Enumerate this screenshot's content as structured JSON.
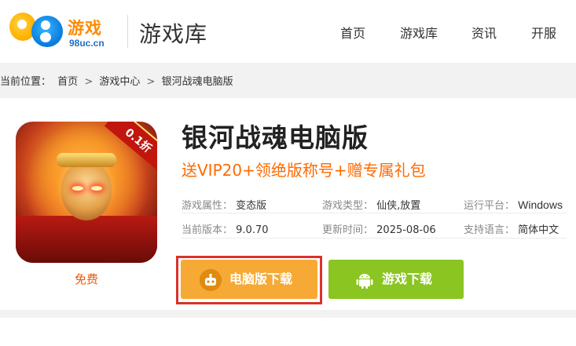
{
  "header": {
    "logo_text": "游戏",
    "logo_sub": "98uc.cn",
    "site_title": "游戏库",
    "nav": [
      "首页",
      "游戏库",
      "资讯",
      "开服"
    ]
  },
  "breadcrumb": {
    "prefix": "当前位置：",
    "items": [
      "首页",
      "游戏中心",
      "银河战魂电脑版"
    ],
    "separator": ">"
  },
  "game": {
    "title": "银河战魂电脑版",
    "promo": "送VIP20+领绝版称号+赠专属礼包",
    "badge": "0.1折",
    "price": "免费",
    "attributes": [
      {
        "key": "游戏属性：",
        "value": "变态版"
      },
      {
        "key": "游戏类型：",
        "value": "仙侠,放置"
      },
      {
        "key": "运行平台：",
        "value": "Windows"
      },
      {
        "key": "当前版本：",
        "value": "9.0.70"
      },
      {
        "key": "更新时间：",
        "value": "2025-08-06"
      },
      {
        "key": "支持语言：",
        "value": "简体中文"
      }
    ]
  },
  "buttons": {
    "pc_download": "电脑版下载",
    "game_download": "游戏下载"
  },
  "colors": {
    "accent_orange": "#f6a935",
    "accent_green": "#8ac522",
    "promo": "#ff6a00",
    "highlight": "#d9322a"
  },
  "icons": {
    "pc_button": "robot-icon",
    "game_button": "android-icon"
  }
}
